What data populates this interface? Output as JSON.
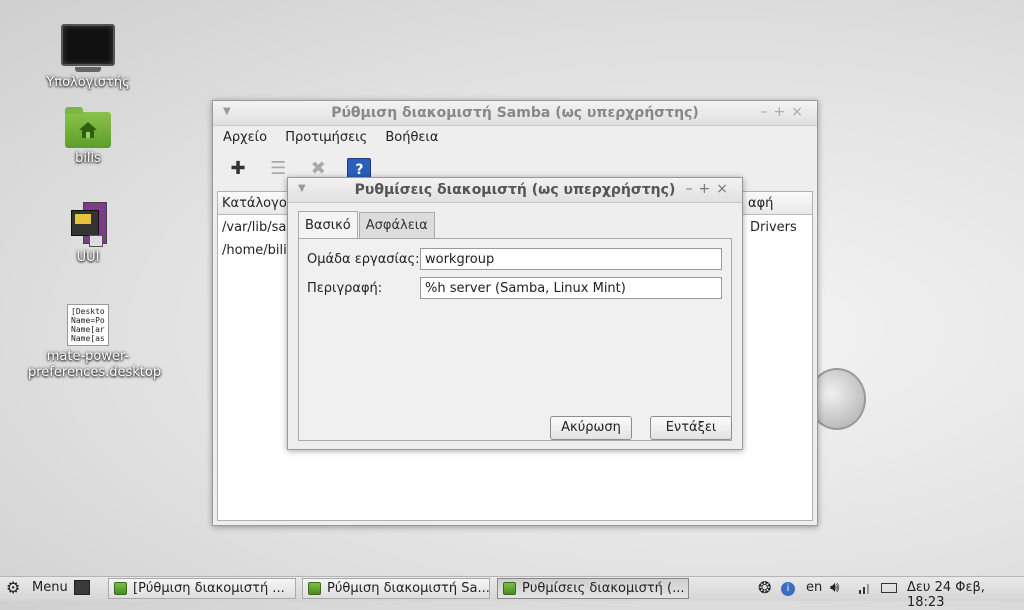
{
  "desktop": {
    "icons": [
      {
        "label": "Υπολογιστής",
        "icon": "computer-icon"
      },
      {
        "label": "bilis",
        "icon": "home-folder-icon"
      },
      {
        "label": "UUI",
        "icon": "sd-card-icon"
      },
      {
        "label": "mate-power-preferences.desktop",
        "label_line1": "mate-power-",
        "label_line2": "preferences.desktop",
        "icon": "desktop-file-icon",
        "preview_lines": [
          "[Deskto",
          "Name=Po",
          "Name[ar",
          "Name[as"
        ]
      }
    ]
  },
  "main_window": {
    "title": "Ρύθμιση διακομιστή Samba (ως υπερχρήστης)",
    "menu": [
      "Αρχείο",
      "Προτιμήσεις",
      "Βοήθεια"
    ],
    "toolbar_icons": [
      "add-icon",
      "properties-icon",
      "delete-icon",
      "help-icon"
    ],
    "help_glyph": "?",
    "columns": {
      "first": "Κατάλογος",
      "last": "αφή"
    },
    "rows": [
      {
        "path": "/var/lib/sam",
        "desc": "Drivers"
      },
      {
        "path": "/home/bilis/",
        "desc": ""
      }
    ]
  },
  "dialog": {
    "title": "Ρυθμίσεις διακομιστή (ως υπερχρήστης)",
    "tabs": [
      {
        "label": "Βασικό",
        "selected": true
      },
      {
        "label": "Ασφάλεια",
        "selected": false
      }
    ],
    "workgroup_label": "Ομάδα εργασίας:",
    "workgroup_value": "workgroup",
    "description_label": "Περιγραφή:",
    "description_value": "%h server (Samba, Linux Mint)",
    "cancel_label": "Ακύρωση",
    "ok_label": "Εντάξει"
  },
  "taskbar": {
    "menu_label": "Menu",
    "items": [
      {
        "label": "[Ρύθμιση διακομιστή ...",
        "active": false
      },
      {
        "label": "Ρύθμιση διακομιστή Sa...",
        "active": false
      },
      {
        "label": "Ρυθμίσεις διακομιστή (...",
        "active": true
      }
    ],
    "keyboard_layout": "en",
    "clock": "Δευ 24 Φεβ, 18:23"
  }
}
